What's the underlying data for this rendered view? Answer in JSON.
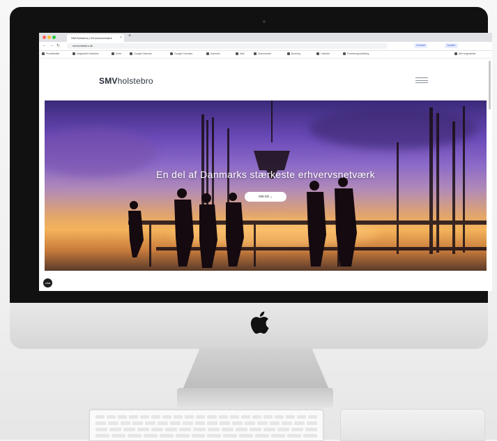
{
  "browser": {
    "tab_title": "SMVholstebro | Erhvervsnetværk",
    "tab_close": "×",
    "new_tab": "+",
    "url": "smvholstebro.dk",
    "nav": {
      "back": "←",
      "forward": "→",
      "reload": "↻"
    },
    "bookmarks": [
      "Produktivitet",
      "Dagbladet Holstebro",
      "Drive",
      "Google Kalender",
      "Google Oversæt",
      "Kalender",
      "Mail",
      "Dokumenter",
      "Booking",
      "LinkedIn",
      "Forretningsudvikling",
      "Alle bogmærker"
    ],
    "extensions": [
      "Genstart",
      "Opdater"
    ]
  },
  "site": {
    "logo_bold": "SMV",
    "logo_rest": "holstebro",
    "hero_heading": "En del af Danmarks stærkeste erhvervsnetværk",
    "cta_label": "OM OS  ⌄",
    "chat_label": "chat"
  },
  "colors": {
    "screen_frame": "#111111",
    "hero_top": "#3a2a7a",
    "hero_sunset": "#f4b35a",
    "logo_text": "#2f3544"
  }
}
